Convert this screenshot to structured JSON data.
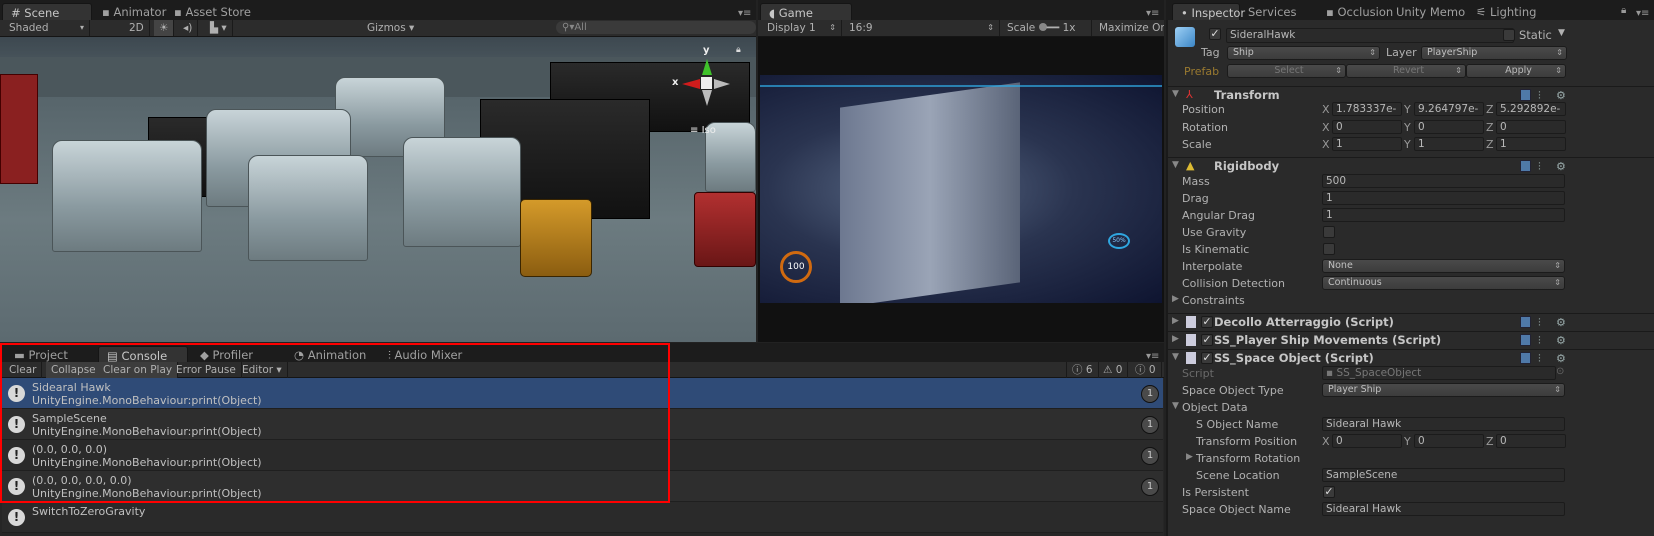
{
  "scene_panel": {
    "tabs": [
      {
        "label": "Scene",
        "icon": "grid-icon",
        "active": true
      },
      {
        "label": "Animator",
        "icon": "animator-icon"
      },
      {
        "label": "Asset Store",
        "icon": "store-icon"
      }
    ],
    "toolbar": {
      "shading": "Shaded",
      "mode_2d": "2D",
      "gizmos": "Gizmos",
      "search_placeholder": "All"
    },
    "gizmo": {
      "y_label": "y",
      "x_label": "x",
      "projection": "Iso"
    }
  },
  "game_panel": {
    "tab": "Game",
    "toolbar": {
      "display": "Display 1",
      "aspect": "16:9",
      "scale_label": "Scale",
      "scale_value": "1x",
      "maximize": "Maximize On Play"
    },
    "hud": {
      "speed": "100",
      "percent": "50%"
    }
  },
  "inspector": {
    "tabs": [
      "Inspector",
      "Services",
      "Occlusion",
      "Unity Memo",
      "Lighting"
    ],
    "object": {
      "name": "SideralHawk",
      "active": true,
      "static_label": "Static",
      "static": false,
      "tag_label": "Tag",
      "tag": "Ship",
      "layer_label": "Layer",
      "layer": "PlayerShip",
      "prefab_label": "Prefab",
      "prefab_buttons": [
        "Select",
        "Revert",
        "Apply"
      ]
    },
    "transform": {
      "title": "Transform",
      "position_label": "Position",
      "position": [
        "1.783337e-",
        "9.264797e-",
        "5.292892e-"
      ],
      "rotation_label": "Rotation",
      "rotation": [
        "0",
        "0",
        "0"
      ],
      "scale_label": "Scale",
      "scale": [
        "1",
        "1",
        "1"
      ]
    },
    "rigidbody": {
      "title": "Rigidbody",
      "mass_label": "Mass",
      "mass": "500",
      "drag_label": "Drag",
      "drag": "1",
      "angular_drag_label": "Angular Drag",
      "angular_drag": "1",
      "use_gravity_label": "Use Gravity",
      "use_gravity": false,
      "is_kinematic_label": "Is Kinematic",
      "is_kinematic": false,
      "interpolate_label": "Interpolate",
      "interpolate": "None",
      "collision_label": "Collision Detection",
      "collision": "Continuous",
      "constraints_label": "Constraints"
    },
    "scripts": [
      {
        "title": "Decollo Atterraggio (Script)",
        "enabled": true
      },
      {
        "title": "SS_Player Ship Movements (Script)",
        "enabled": true
      },
      {
        "title": "SS_Space Object (Script)",
        "enabled": true
      }
    ],
    "space_object": {
      "script_label": "Script",
      "script": "SS_SpaceObject",
      "type_label": "Space Object Type",
      "type": "Player Ship",
      "object_data_label": "Object Data",
      "s_object_name_label": "S Object Name",
      "s_object_name": "Sidearal Hawk",
      "transform_position_label": "Transform Position",
      "transform_position": [
        "0",
        "0",
        "0"
      ],
      "transform_rotation_label": "Transform Rotation",
      "scene_location_label": "Scene Location",
      "scene_location": "SampleScene",
      "is_persistent_label": "Is Persistent",
      "is_persistent": true,
      "cut_label": "Space Object Name",
      "cut_value": "Sidearal Hawk"
    },
    "axis": [
      "X",
      "Y",
      "Z"
    ]
  },
  "console_panel": {
    "tabs": [
      {
        "label": "Project"
      },
      {
        "label": "Console",
        "active": true
      },
      {
        "label": "Profiler"
      },
      {
        "label": "Animation"
      },
      {
        "label": "Audio Mixer"
      }
    ],
    "toolbar": [
      "Clear",
      "Collapse",
      "Clear on Play",
      "Error Pause",
      "Editor"
    ],
    "counts": {
      "info": "6",
      "warnings": "0",
      "errors": "0"
    },
    "entries": [
      {
        "message": "Sidearal Hawk",
        "trace": "UnityEngine.MonoBehaviour:print(Object)",
        "count": "1",
        "selected": true
      },
      {
        "message": "SampleScene",
        "trace": "UnityEngine.MonoBehaviour:print(Object)",
        "count": "1"
      },
      {
        "message": "(0.0, 0.0, 0.0)",
        "trace": "UnityEngine.MonoBehaviour:print(Object)",
        "count": "1"
      },
      {
        "message": "(0.0, 0.0, 0.0, 0.0)",
        "trace": "UnityEngine.MonoBehaviour:print(Object)",
        "count": "1"
      },
      {
        "message": "SwitchToZeroGravity"
      }
    ],
    "highlight_color": "#ff0000"
  }
}
